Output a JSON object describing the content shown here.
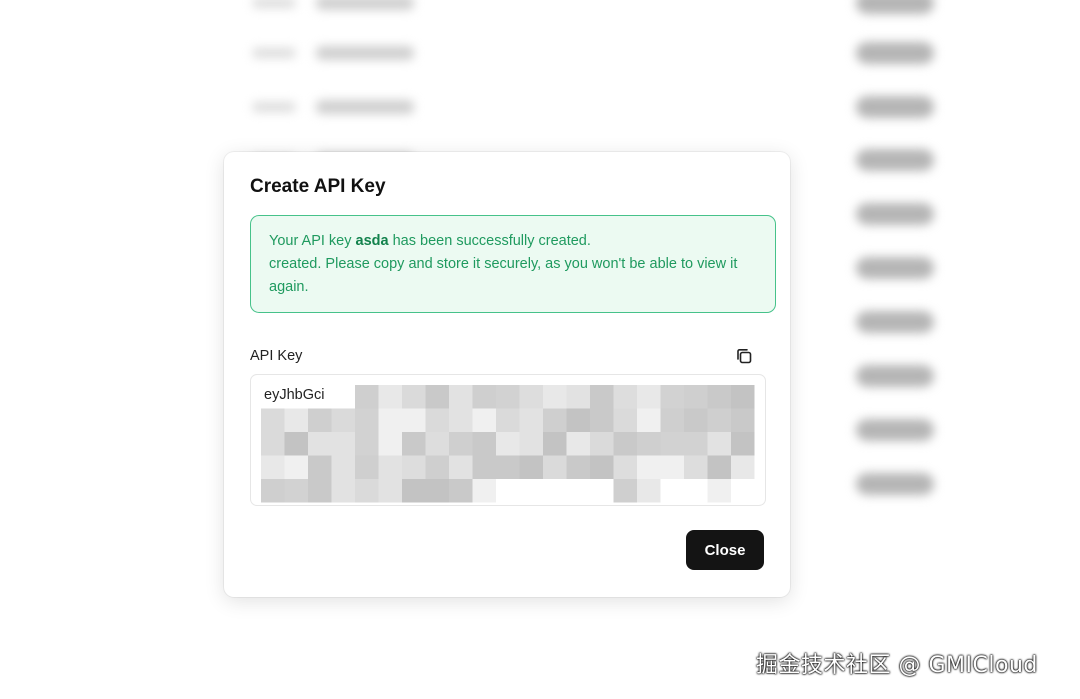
{
  "modal": {
    "title": "Create API Key",
    "alert": {
      "prefix": "Your API key ",
      "key_name": "asda",
      "suffix": " has been successfully created.",
      "body": "created. Please copy and store it securely, as you won't be able to view it again."
    },
    "field_label": "API Key",
    "key_value_visible": "eyJhbGci",
    "close_label": "Close",
    "copy_icon": "copy-icon"
  },
  "watermark": "掘金技术社区 @ GMICloud",
  "colors": {
    "alert_bg": "#ecfaf2",
    "alert_border": "#46c28a",
    "alert_text": "#1f9a5f",
    "button_bg": "#141414"
  }
}
